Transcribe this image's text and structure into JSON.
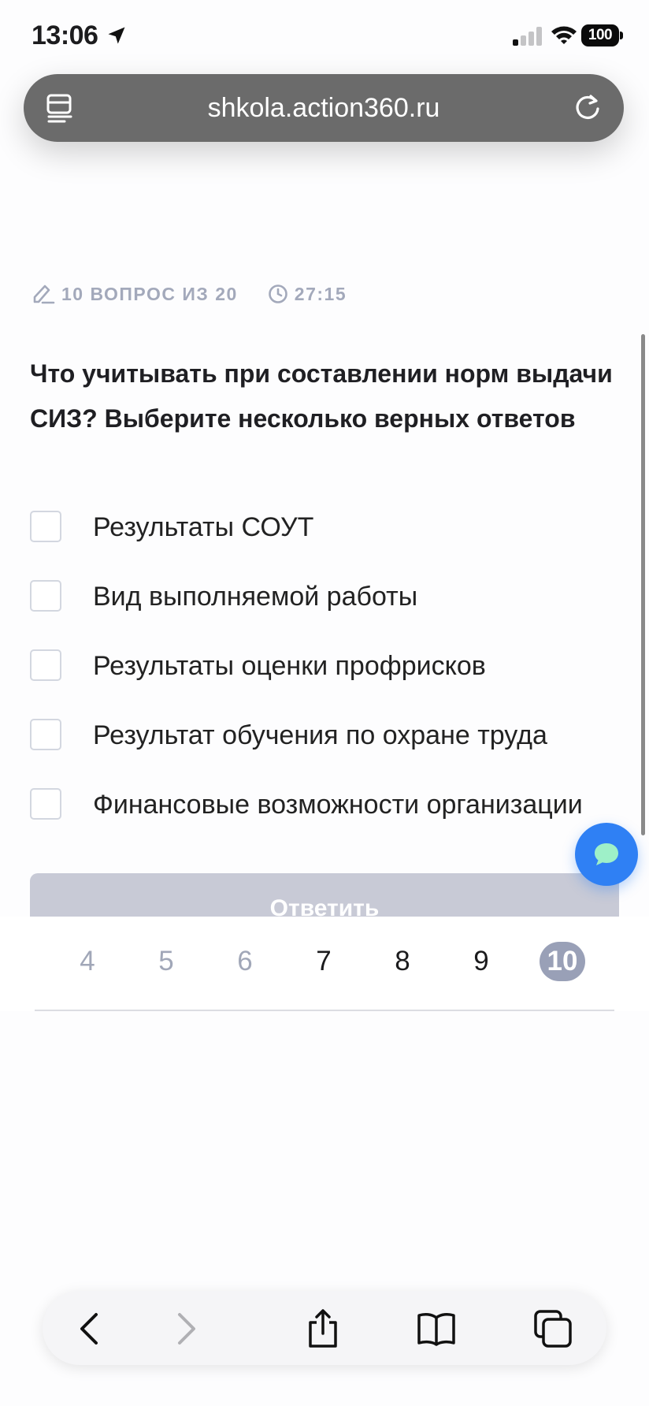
{
  "status_bar": {
    "time": "13:06",
    "battery": "100"
  },
  "browser": {
    "url": "shkola.action360.ru"
  },
  "quiz": {
    "progress_text": "10 ВОПРОС ИЗ 20",
    "timer": "27:15",
    "question": "Что учитывать при составлении норм выдачи СИЗ? Выберите несколько верных ответов",
    "options": [
      {
        "label": "Результаты СОУТ",
        "checked": false
      },
      {
        "label": "Вид выполняемой работы",
        "checked": false
      },
      {
        "label": "Результаты оценки профрисков",
        "checked": false
      },
      {
        "label": "Результат обучения по охране труда",
        "checked": false
      },
      {
        "label": "Финансовые возможности организации",
        "checked": false
      }
    ],
    "submit_label": "Ответить"
  },
  "pagination": {
    "pages": [
      "4",
      "5",
      "6",
      "7",
      "8",
      "9",
      "10"
    ],
    "current": "10"
  },
  "colors": {
    "accent": "#2f80f4",
    "muted": "#a3a9bb",
    "current_page": "#99a0b7",
    "button_disabled": "#c8cad6"
  },
  "icons": {
    "meta": [
      "pen-icon",
      "clock-icon"
    ],
    "toolbar": [
      "back-icon",
      "forward-icon",
      "share-icon",
      "bookmarks-icon",
      "tabs-icon"
    ]
  }
}
